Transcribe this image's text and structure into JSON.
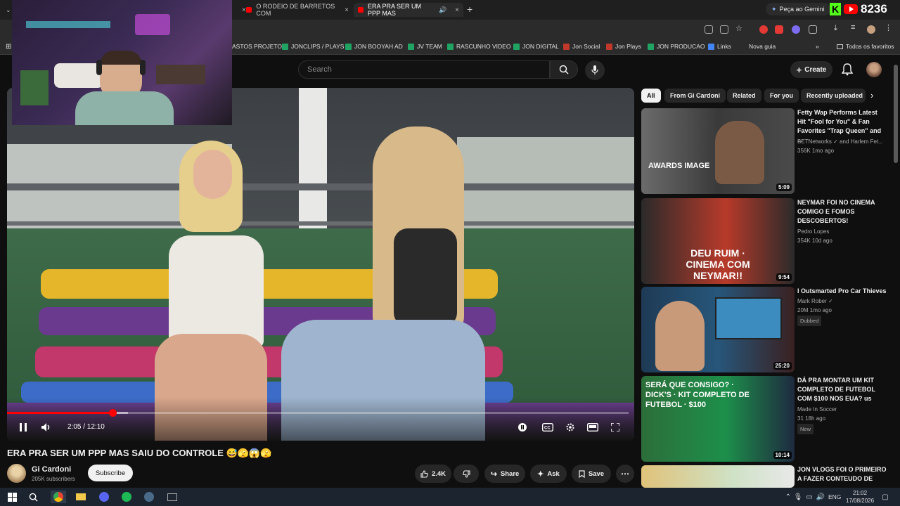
{
  "browser": {
    "tabs": [
      {
        "title": "O RODEIO DE BARRETOS COM",
        "active": false
      },
      {
        "title": "ERA PRA SER UM PPP MAS",
        "active": true
      }
    ],
    "gemini_label": "Peça ao Gemini",
    "viewer_count": "8236"
  },
  "bookmarks": {
    "items": [
      "ASTOS PROJETO",
      "JONCLIPS / PLAYS",
      "JON BOOYAH AD",
      "JV TEAM",
      "RASCUNHO VIDEO",
      "JON DIGITAL",
      "Jon Social",
      "Jon Plays",
      "JON PRODUCAO",
      "Links",
      "Nova guia"
    ],
    "all_favorites": "Todos os favoritos"
  },
  "youtube": {
    "search_placeholder": "Search",
    "create_label": "Create"
  },
  "player": {
    "time": "2:05 / 12:10",
    "progress": 0.17,
    "buffered": 0.195
  },
  "video": {
    "title": "ERA PRA SER UM PPP MAS SAIU DO CONTROLE 😅🫣😱🫣",
    "channel": "Gi Cardoni",
    "subscribers": "205K subscribers",
    "subscribe_label": "Subscribe",
    "likes": "2.4K",
    "share_label": "Share",
    "ask_label": "Ask",
    "save_label": "Save"
  },
  "chips": [
    "All",
    "From Gi Cardoni",
    "Related",
    "For you",
    "Recently uploaded"
  ],
  "recommendations": [
    {
      "title": "Fetty Wap Performs Latest Hit \"Fool for You\" & Fan Favorites \"Trap Queen\" and ...",
      "channel": "BETNetworks ✓ and Harlem Fet...",
      "meta": "356K  1mo ago",
      "duration": "5:09",
      "thumb_text": "AWARDS IMAGE"
    },
    {
      "title": "NEYMAR FOI NO CINEMA COMIGO E FOMOS DESCOBERTOS!",
      "channel": "Pedro Lopes",
      "meta": "354K  10d ago",
      "duration": "9:54",
      "thumb_text": "DEU RUIM · CINEMA COM NEYMAR!!"
    },
    {
      "title": "I Outsmarted Pro Car Thieves",
      "channel": "Mark Rober ✓",
      "meta": "20M  1mo ago",
      "badge": "Dubbed",
      "duration": "25:20"
    },
    {
      "title": "DÁ PRA MONTAR UM KIT COMPLETO DE FUTEBOL COM $100 NOS EUA? us",
      "channel": "Made In Soccer",
      "meta": "31  18h ago",
      "badge": "New",
      "duration": "10:14",
      "thumb_text": "SERÁ QUE CONSIGO? · DICK'S · KIT COMPLETO DE FUTEBOL · $100"
    },
    {
      "title": "JON VLOGS FOI O PRIMEIRO A FAZER CONTEUDO DE",
      "channel": "",
      "meta": "",
      "duration": ""
    }
  ],
  "taskbar": {
    "lang": "ENG",
    "time": "21:02",
    "date": "17/08/2026"
  },
  "colors": {
    "accent": "#ff0000",
    "bg": "#0f0f0f",
    "kick": "#53fc18"
  }
}
